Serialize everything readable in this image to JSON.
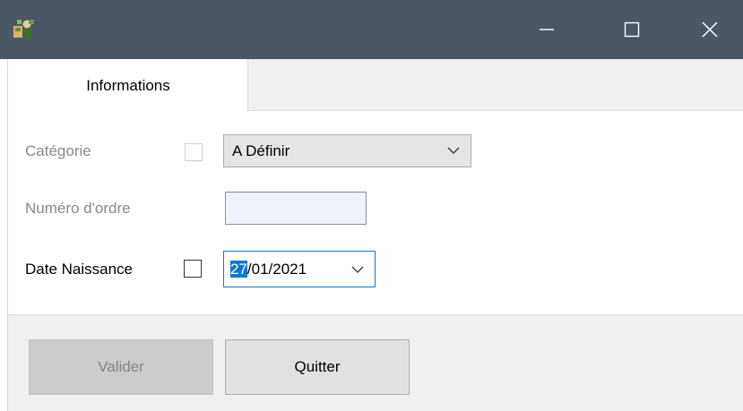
{
  "window": {
    "icon": "app-icon",
    "controls": [
      "minimize-icon",
      "maximize-icon",
      "close-icon"
    ],
    "titlebar_color": "#4c5766"
  },
  "tabs": [
    {
      "label": "Informations",
      "active": true
    }
  ],
  "form": {
    "categorie": {
      "label": "Catégorie",
      "checked": false,
      "enabled": false,
      "value": "A Définir"
    },
    "numero_ordre": {
      "label": "Numéro d'ordre",
      "value": "",
      "enabled": false
    },
    "date_naissance": {
      "label": "Date Naissance",
      "checked": false,
      "value_selected": "27",
      "value_rest": "/01/2021"
    }
  },
  "buttons": {
    "valider": {
      "label": "Valider",
      "enabled": false
    },
    "quitter": {
      "label": "Quitter",
      "enabled": true
    }
  },
  "colors": {
    "selection": "#0f78d7",
    "focus_border": "#1975d1"
  }
}
